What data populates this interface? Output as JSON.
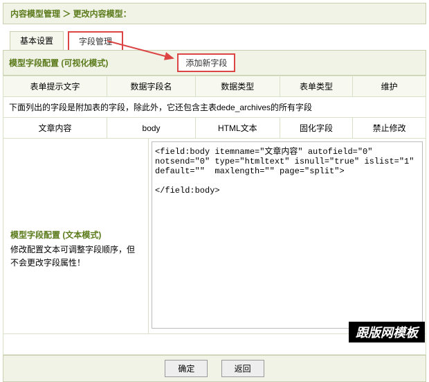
{
  "breadcrumb": "内容模型管理 ＞ 更改内容模型：",
  "tabs": {
    "basic": "基本设置",
    "fields": "字段管理"
  },
  "section1": {
    "title": "模型字段配置 (可视化模式)",
    "addBtn": "添加新字段"
  },
  "table": {
    "headers": [
      "表单提示文字",
      "数据字段名",
      "数据类型",
      "表单类型",
      "维护"
    ],
    "note": "下面列出的字段是附加表的字段，除此外，它还包含主表dede_archives的所有字段",
    "row": [
      "文章内容",
      "body",
      "HTML文本",
      "固化字段",
      "禁止修改"
    ]
  },
  "section2": {
    "title": "模型字段配置 (文本模式)",
    "desc": "修改配置文本可调整字段顺序，但不会更改字段属性！"
  },
  "codeText": "<field:body itemname=\"文章内容\" autofield=\"0\" notsend=\"0\" type=\"htmltext\" isnull=\"true\" islist=\"1\" default=\"\"  maxlength=\"\" page=\"split\">\n\n</field:body>",
  "buttons": {
    "ok": "确定",
    "back": "返回"
  },
  "watermark": "跟版网模板"
}
